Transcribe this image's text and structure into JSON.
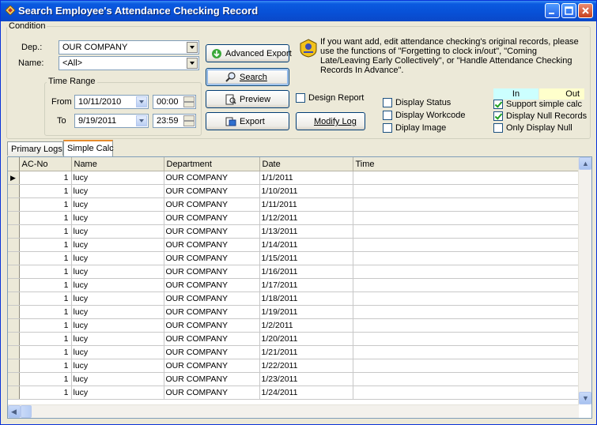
{
  "window": {
    "title": "Search Employee's Attendance Checking Record",
    "controls": [
      "minimize",
      "maximize",
      "close"
    ]
  },
  "condition": {
    "legend": "Condition",
    "dept_label": "Dep.:",
    "dept_value": "OUR COMPANY",
    "name_label": "Name:",
    "name_value": "<All>"
  },
  "time_range": {
    "legend": "Time Range",
    "from_label": "From",
    "from_date": "10/11/2010",
    "from_time": "00:00",
    "to_label": "To",
    "to_date": "9/19/2011",
    "to_time": "23:59"
  },
  "buttons": {
    "advanced_export": "Advanced Export",
    "search": "Search",
    "preview": "Preview",
    "export": "Export",
    "modify_log": "Modify Log"
  },
  "info_text": "If you want add, edit attendance checking's original records, please use the functions of \"Forgetting to clock in/out\", \"Coming Late/Leaving Early Collectively\", or \"Handle Attendance Checking Records In Advance\".",
  "legend_colors": {
    "in_label": "In",
    "in_color": "#ccffff",
    "out_label": "Out",
    "out_color": "#ffffcc"
  },
  "options": {
    "design_report": {
      "label": "Design Report",
      "checked": false
    },
    "display_status": {
      "label": "Display Status",
      "checked": false
    },
    "display_workcode": {
      "label": "Display Workcode",
      "checked": false
    },
    "diplay_image": {
      "label": "Diplay Image",
      "checked": false
    },
    "support_simple_calc": {
      "label": "Support simple calc",
      "checked": true
    },
    "display_null_records": {
      "label": "Display Null Records",
      "checked": true
    },
    "only_display_null": {
      "label": "Only Display Null",
      "checked": false
    }
  },
  "tabs": [
    {
      "label": "Primary Logs",
      "active": false
    },
    {
      "label": "Simple Calc",
      "active": true
    }
  ],
  "grid": {
    "columns": [
      "AC-No",
      "Name",
      "Department",
      "Date",
      "Time"
    ],
    "rows": [
      {
        "ac_no": "1",
        "name": "lucy",
        "department": "OUR COMPANY",
        "date": "1/1/2011",
        "time": ""
      },
      {
        "ac_no": "1",
        "name": "lucy",
        "department": "OUR COMPANY",
        "date": "1/10/2011",
        "time": ""
      },
      {
        "ac_no": "1",
        "name": "lucy",
        "department": "OUR COMPANY",
        "date": "1/11/2011",
        "time": ""
      },
      {
        "ac_no": "1",
        "name": "lucy",
        "department": "OUR COMPANY",
        "date": "1/12/2011",
        "time": ""
      },
      {
        "ac_no": "1",
        "name": "lucy",
        "department": "OUR COMPANY",
        "date": "1/13/2011",
        "time": ""
      },
      {
        "ac_no": "1",
        "name": "lucy",
        "department": "OUR COMPANY",
        "date": "1/14/2011",
        "time": ""
      },
      {
        "ac_no": "1",
        "name": "lucy",
        "department": "OUR COMPANY",
        "date": "1/15/2011",
        "time": ""
      },
      {
        "ac_no": "1",
        "name": "lucy",
        "department": "OUR COMPANY",
        "date": "1/16/2011",
        "time": ""
      },
      {
        "ac_no": "1",
        "name": "lucy",
        "department": "OUR COMPANY",
        "date": "1/17/2011",
        "time": ""
      },
      {
        "ac_no": "1",
        "name": "lucy",
        "department": "OUR COMPANY",
        "date": "1/18/2011",
        "time": ""
      },
      {
        "ac_no": "1",
        "name": "lucy",
        "department": "OUR COMPANY",
        "date": "1/19/2011",
        "time": ""
      },
      {
        "ac_no": "1",
        "name": "lucy",
        "department": "OUR COMPANY",
        "date": "1/2/2011",
        "time": ""
      },
      {
        "ac_no": "1",
        "name": "lucy",
        "department": "OUR COMPANY",
        "date": "1/20/2011",
        "time": ""
      },
      {
        "ac_no": "1",
        "name": "lucy",
        "department": "OUR COMPANY",
        "date": "1/21/2011",
        "time": ""
      },
      {
        "ac_no": "1",
        "name": "lucy",
        "department": "OUR COMPANY",
        "date": "1/22/2011",
        "time": ""
      },
      {
        "ac_no": "1",
        "name": "lucy",
        "department": "OUR COMPANY",
        "date": "1/23/2011",
        "time": ""
      },
      {
        "ac_no": "1",
        "name": "lucy",
        "department": "OUR COMPANY",
        "date": "1/24/2011",
        "time": ""
      }
    ]
  }
}
